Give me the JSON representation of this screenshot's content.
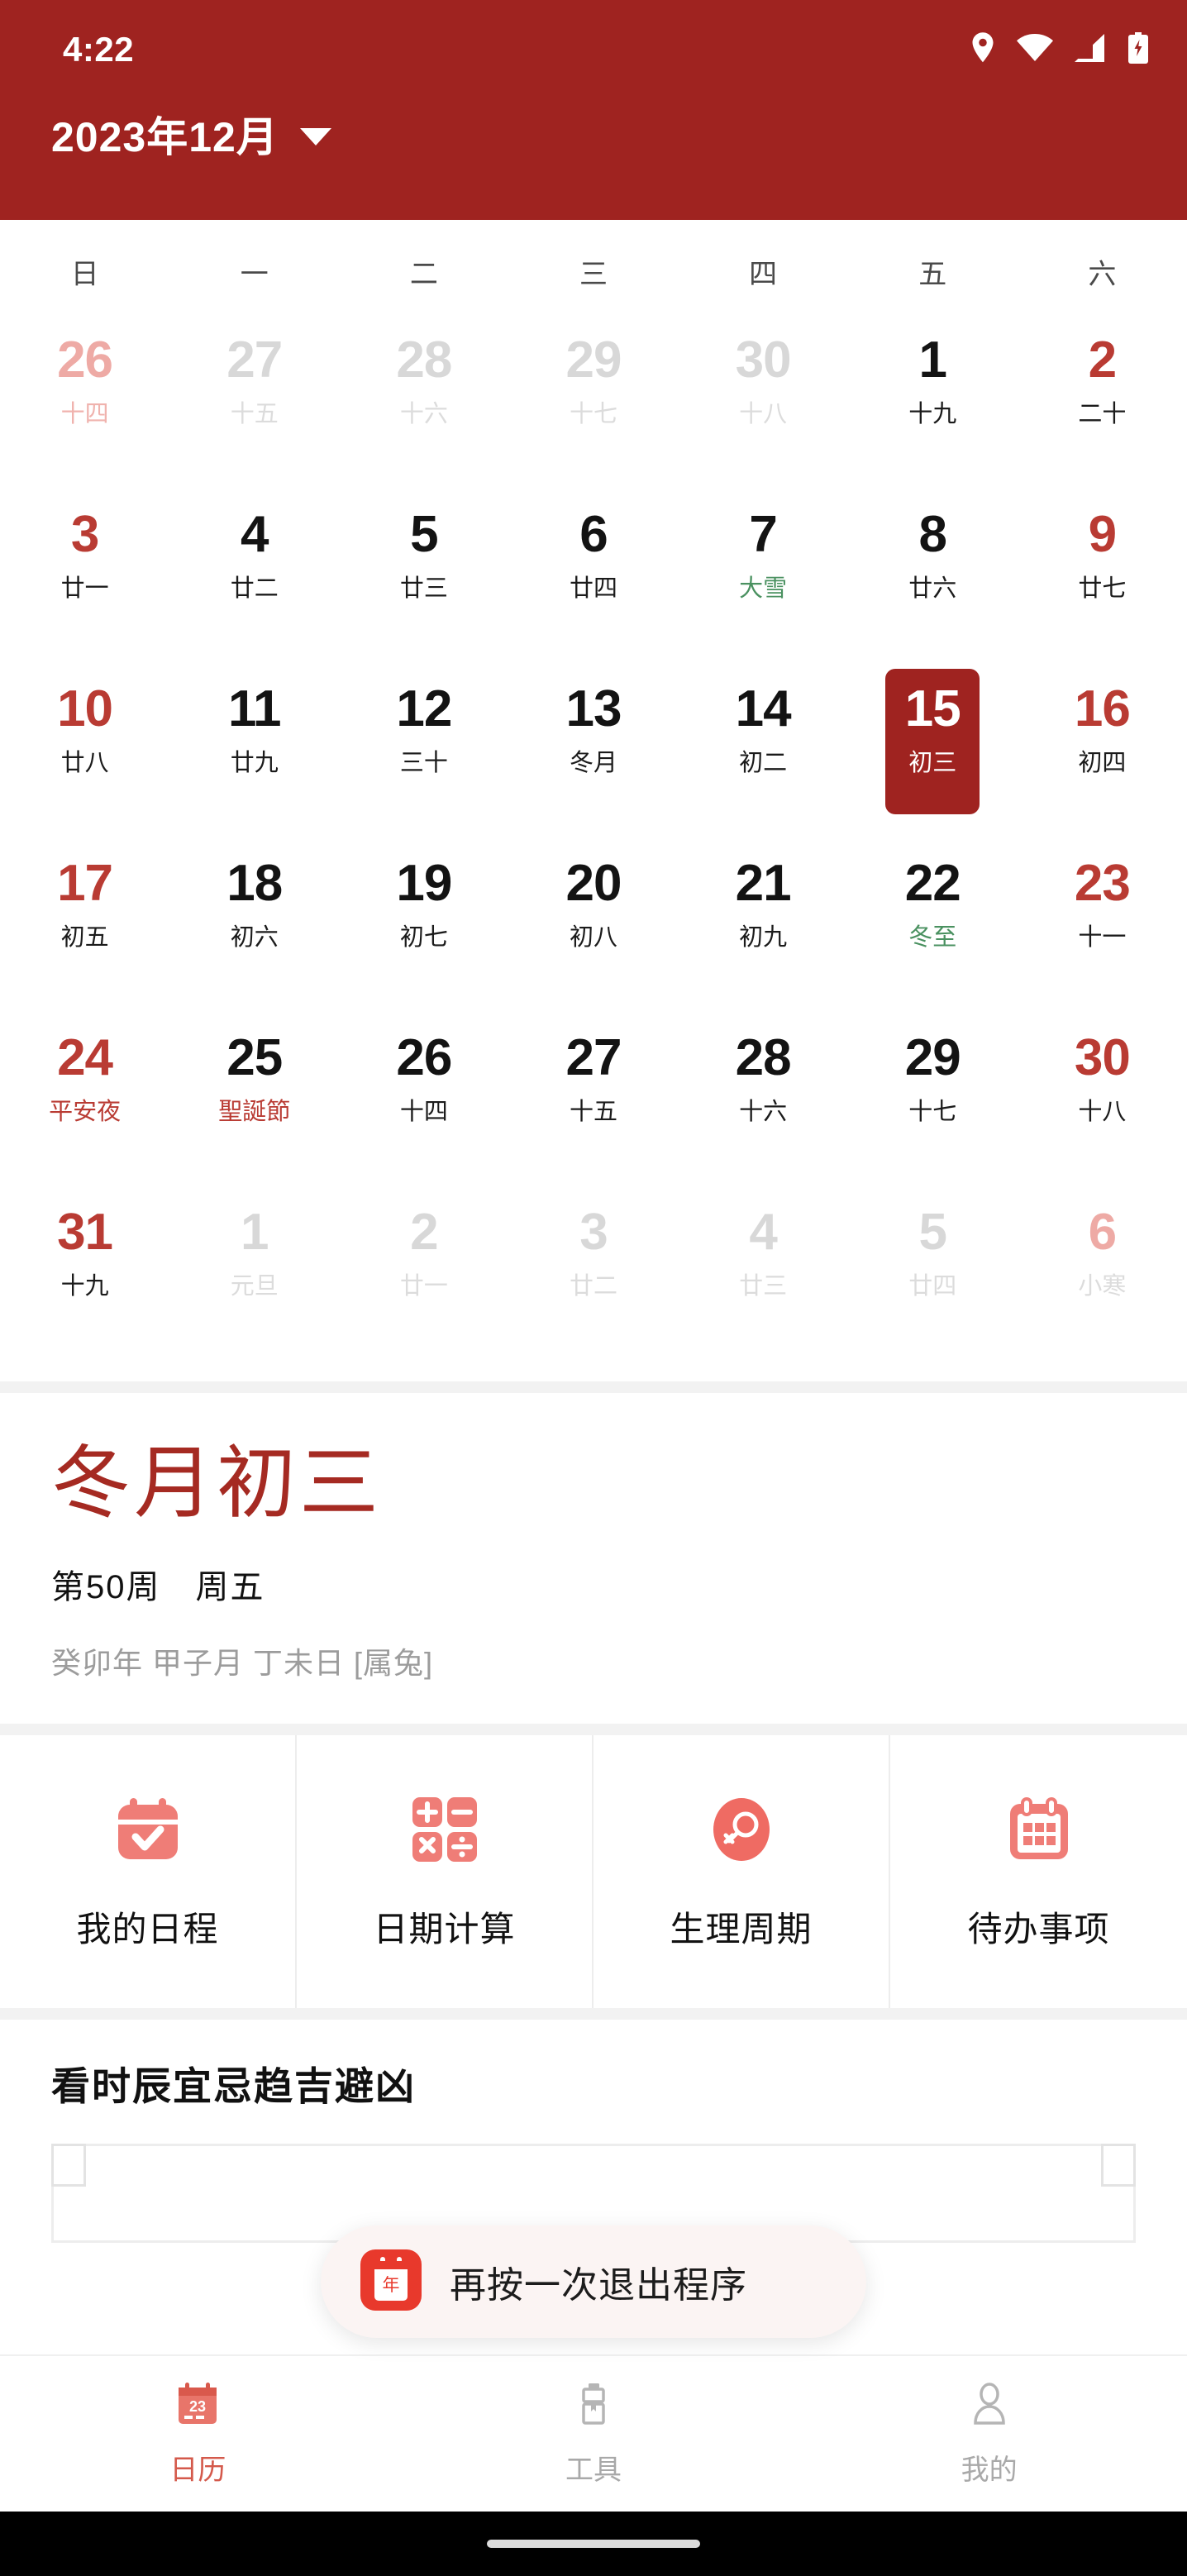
{
  "status_bar": {
    "time": "4:22",
    "icons": [
      "location-pin-icon",
      "wifi-icon",
      "signal-icon",
      "battery-charging-icon"
    ]
  },
  "header": {
    "title": "2023年12月",
    "dropdown_icon": "chevron-down-icon",
    "background_color": "#9f2320"
  },
  "calendar": {
    "weekdays": [
      "日",
      "一",
      "二",
      "三",
      "四",
      "五",
      "六"
    ],
    "selected_day": 15,
    "weeks": [
      [
        {
          "num": "26",
          "sub": "十四",
          "num_class": "mutedred",
          "sub_class": "mutedred",
          "muted": true
        },
        {
          "num": "27",
          "sub": "十五",
          "num_class": "mutedgray",
          "sub_class": "mutedgray",
          "muted": true
        },
        {
          "num": "28",
          "sub": "十六",
          "num_class": "mutedgray",
          "sub_class": "mutedgray",
          "muted": true
        },
        {
          "num": "29",
          "sub": "十七",
          "num_class": "mutedgray",
          "sub_class": "mutedgray",
          "muted": true
        },
        {
          "num": "30",
          "sub": "十八",
          "num_class": "mutedgray",
          "sub_class": "mutedgray",
          "muted": true
        },
        {
          "num": "1",
          "sub": "十九",
          "num_class": "black",
          "sub_class": "black",
          "muted": false
        },
        {
          "num": "2",
          "sub": "二十",
          "num_class": "red",
          "sub_class": "black",
          "muted": false
        }
      ],
      [
        {
          "num": "3",
          "sub": "廿一",
          "num_class": "red",
          "sub_class": "black",
          "muted": false
        },
        {
          "num": "4",
          "sub": "廿二",
          "num_class": "black",
          "sub_class": "black",
          "muted": false
        },
        {
          "num": "5",
          "sub": "廿三",
          "num_class": "black",
          "sub_class": "black",
          "muted": false
        },
        {
          "num": "6",
          "sub": "廿四",
          "num_class": "black",
          "sub_class": "black",
          "muted": false
        },
        {
          "num": "7",
          "sub": "大雪",
          "num_class": "black",
          "sub_class": "green",
          "muted": false
        },
        {
          "num": "8",
          "sub": "廿六",
          "num_class": "black",
          "sub_class": "black",
          "muted": false
        },
        {
          "num": "9",
          "sub": "廿七",
          "num_class": "red",
          "sub_class": "black",
          "muted": false
        }
      ],
      [
        {
          "num": "10",
          "sub": "廿八",
          "num_class": "red",
          "sub_class": "black",
          "muted": false
        },
        {
          "num": "11",
          "sub": "廿九",
          "num_class": "black",
          "sub_class": "black",
          "muted": false
        },
        {
          "num": "12",
          "sub": "三十",
          "num_class": "black",
          "sub_class": "black",
          "muted": false
        },
        {
          "num": "13",
          "sub": "冬月",
          "num_class": "black",
          "sub_class": "black",
          "muted": false
        },
        {
          "num": "14",
          "sub": "初二",
          "num_class": "black",
          "sub_class": "black",
          "muted": false
        },
        {
          "num": "15",
          "sub": "初三",
          "num_class": "black",
          "sub_class": "black",
          "muted": false,
          "selected": true
        },
        {
          "num": "16",
          "sub": "初四",
          "num_class": "red",
          "sub_class": "black",
          "muted": false
        }
      ],
      [
        {
          "num": "17",
          "sub": "初五",
          "num_class": "red",
          "sub_class": "black",
          "muted": false
        },
        {
          "num": "18",
          "sub": "初六",
          "num_class": "black",
          "sub_class": "black",
          "muted": false
        },
        {
          "num": "19",
          "sub": "初七",
          "num_class": "black",
          "sub_class": "black",
          "muted": false
        },
        {
          "num": "20",
          "sub": "初八",
          "num_class": "black",
          "sub_class": "black",
          "muted": false
        },
        {
          "num": "21",
          "sub": "初九",
          "num_class": "black",
          "sub_class": "black",
          "muted": false
        },
        {
          "num": "22",
          "sub": "冬至",
          "num_class": "black",
          "sub_class": "green",
          "muted": false
        },
        {
          "num": "23",
          "sub": "十一",
          "num_class": "red",
          "sub_class": "black",
          "muted": false
        }
      ],
      [
        {
          "num": "24",
          "sub": "平安夜",
          "num_class": "red",
          "sub_class": "red",
          "muted": false
        },
        {
          "num": "25",
          "sub": "聖誕節",
          "num_class": "black",
          "sub_class": "red",
          "muted": false
        },
        {
          "num": "26",
          "sub": "十四",
          "num_class": "black",
          "sub_class": "black",
          "muted": false
        },
        {
          "num": "27",
          "sub": "十五",
          "num_class": "black",
          "sub_class": "black",
          "muted": false
        },
        {
          "num": "28",
          "sub": "十六",
          "num_class": "black",
          "sub_class": "black",
          "muted": false
        },
        {
          "num": "29",
          "sub": "十七",
          "num_class": "black",
          "sub_class": "black",
          "muted": false
        },
        {
          "num": "30",
          "sub": "十八",
          "num_class": "red",
          "sub_class": "black",
          "muted": false
        }
      ],
      [
        {
          "num": "31",
          "sub": "十九",
          "num_class": "red",
          "sub_class": "black",
          "muted": false
        },
        {
          "num": "1",
          "sub": "元旦",
          "num_class": "mutedgray",
          "sub_class": "mutedgray",
          "muted": true
        },
        {
          "num": "2",
          "sub": "廿一",
          "num_class": "mutedgray",
          "sub_class": "mutedgray",
          "muted": true
        },
        {
          "num": "3",
          "sub": "廿二",
          "num_class": "mutedgray",
          "sub_class": "mutedgray",
          "muted": true
        },
        {
          "num": "4",
          "sub": "廿三",
          "num_class": "mutedgray",
          "sub_class": "mutedgray",
          "muted": true
        },
        {
          "num": "5",
          "sub": "廿四",
          "num_class": "mutedgray",
          "sub_class": "mutedgray",
          "muted": true
        },
        {
          "num": "6",
          "sub": "小寒",
          "num_class": "mutedred",
          "sub_class": "mutedgray",
          "muted": true
        }
      ]
    ]
  },
  "detail": {
    "lunar_date": "冬月初三",
    "week_line": "第50周　周五",
    "ganzhi": "癸卯年 甲子月 丁未日 [属兔]",
    "lunar_color": "#a52a22"
  },
  "tools": [
    {
      "label": "我的日程",
      "icon": "calendar-check-icon"
    },
    {
      "label": "日期计算",
      "icon": "calculator-icon"
    },
    {
      "label": "生理周期",
      "icon": "female-cycle-icon"
    },
    {
      "label": "待办事项",
      "icon": "calendar-grid-icon"
    }
  ],
  "almanac": {
    "title": "看时辰宜忌趋吉避凶"
  },
  "toast": {
    "text": "再按一次退出程序",
    "icon": "app-calendar-icon",
    "icon_char": "年"
  },
  "bottom_nav": {
    "items": [
      {
        "label": "日历",
        "icon": "calendar-23-icon",
        "active": true
      },
      {
        "label": "工具",
        "icon": "toolbox-icon",
        "active": false
      },
      {
        "label": "我的",
        "icon": "person-icon",
        "active": false
      }
    ]
  }
}
